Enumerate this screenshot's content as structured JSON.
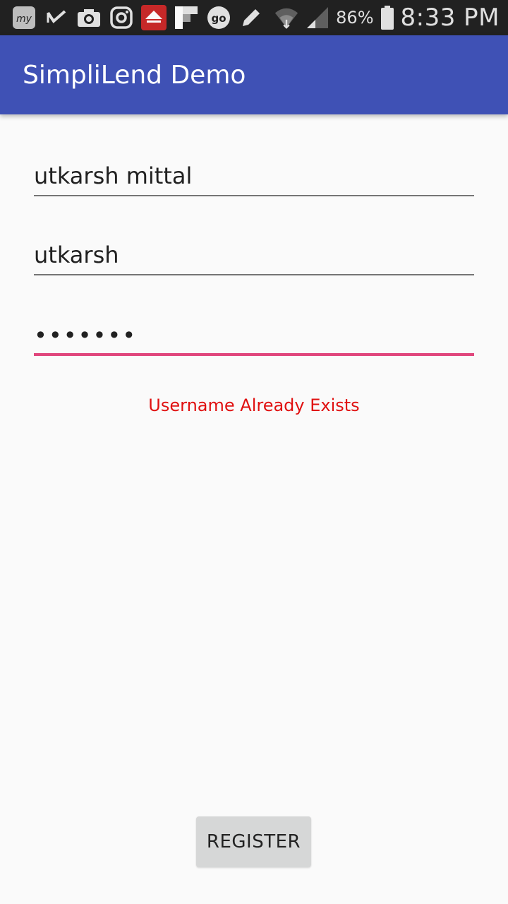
{
  "status_bar": {
    "icons": [
      "myntra-icon",
      "check-mark-icon",
      "camera-icon",
      "instagram-icon",
      "pizza-hut-icon",
      "flipboard-icon",
      "goibibo-icon",
      "pencil-icon"
    ],
    "battery_percent": "86%",
    "time": "8:33 PM"
  },
  "app_bar": {
    "title": "SimpliLend Demo",
    "color": "#3f51b5"
  },
  "form": {
    "name_value": "utkarsh mittal",
    "username_value": "utkarsh",
    "password_value": "•••••••",
    "active_underline_color": "#e0467c"
  },
  "error": {
    "message": "Username Already Exists",
    "color": "#e01010"
  },
  "actions": {
    "register_label": "REGISTER"
  }
}
